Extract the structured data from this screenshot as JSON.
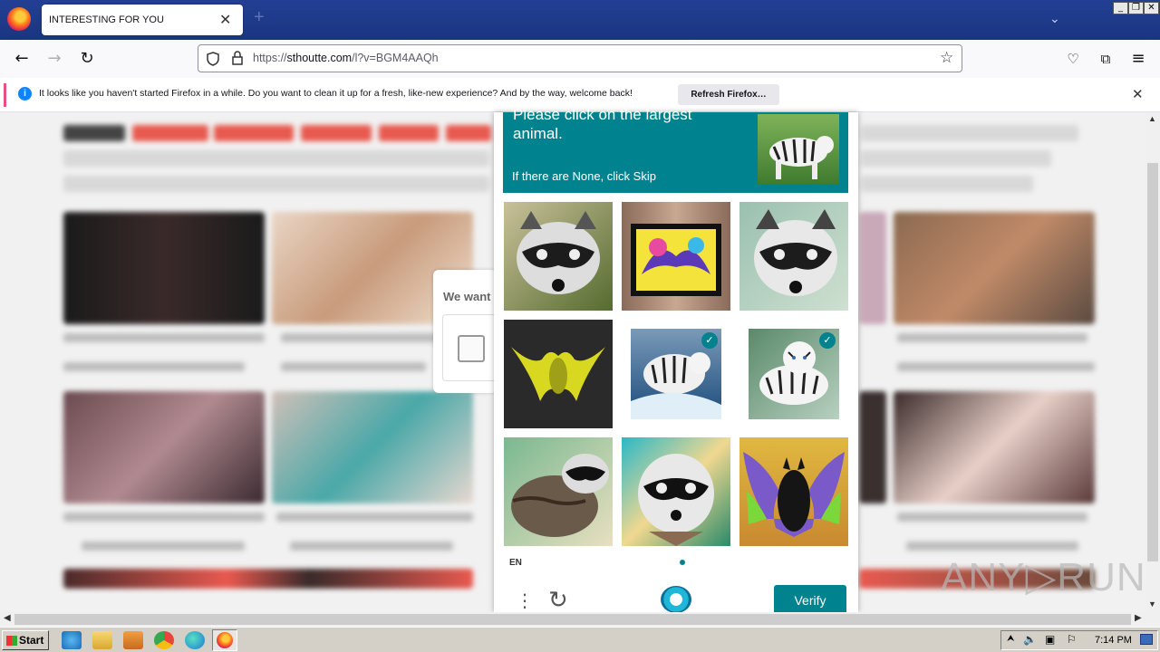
{
  "browser": {
    "tab_title": "INTERESTING FOR YOU",
    "tab_close": "✕",
    "new_tab": "+",
    "url_host": "sthoutte.com",
    "url_prefix": "https://",
    "url_path": "/l?v=BGM4AAQh",
    "window_buttons": [
      "_",
      "❐",
      "✕"
    ]
  },
  "notification": {
    "text": "It looks like you haven't started Firefox in a while. Do you want to clean it up for a fresh, like-new experience? And by the way, welcome back!",
    "button": "Refresh Firefox…",
    "close": "✕"
  },
  "background_dialog": {
    "text": "We want"
  },
  "captcha": {
    "prompt_title": "Please click on the largest animal.",
    "prompt_sub": "If there are None, click Skip",
    "tiles": [
      {
        "name": "raccoon",
        "selected": false
      },
      {
        "name": "bat-painting",
        "selected": false
      },
      {
        "name": "raccoon",
        "selected": false
      },
      {
        "name": "bat",
        "selected": false
      },
      {
        "name": "tiger",
        "selected": true
      },
      {
        "name": "tiger",
        "selected": true
      },
      {
        "name": "raccoon",
        "selected": false
      },
      {
        "name": "raccoon",
        "selected": false
      },
      {
        "name": "bat",
        "selected": false
      }
    ],
    "language": "EN",
    "verify_label": "Verify",
    "check_mark": "✓"
  },
  "watermark": "ANY▷RUN",
  "taskbar": {
    "start_label": "Start",
    "clock": "7:14 PM"
  },
  "colors": {
    "teal": "#00838f",
    "titlebar": "#1f3c8b",
    "taskbar": "#d4d0c8"
  }
}
